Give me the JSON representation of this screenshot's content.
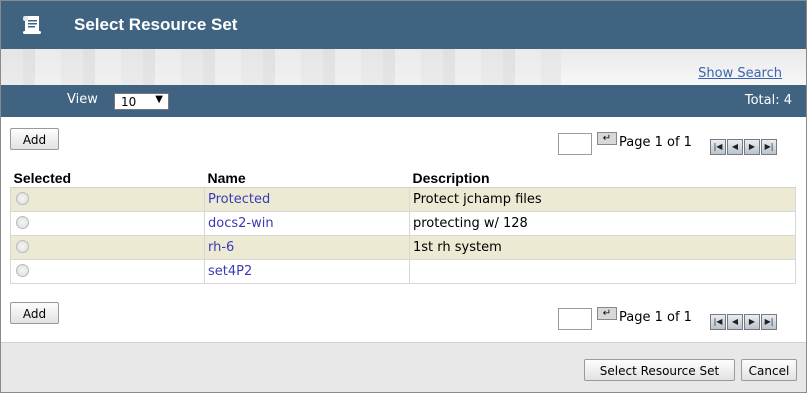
{
  "dialog": {
    "title": "Select Resource Set"
  },
  "search": {
    "show_search_label": "Show Search"
  },
  "viewbar": {
    "view_label": "View",
    "page_size": "10",
    "total_label": "Total: 4"
  },
  "toolbar": {
    "add_label": "Add",
    "page_text": "Page 1 of 1"
  },
  "table": {
    "headers": [
      "Selected",
      "Name",
      "Description"
    ],
    "rows": [
      {
        "name": "Protected",
        "description": "Protect jchamp files"
      },
      {
        "name": "docs2-win",
        "description": "protecting w/ 128"
      },
      {
        "name": "rh-6",
        "description": "1st rh system"
      },
      {
        "name": "set4P2",
        "description": ""
      }
    ]
  },
  "footer": {
    "select_label": "Select Resource Set",
    "cancel_label": "Cancel"
  },
  "icons": {
    "title": "scroll-icon",
    "go": "go-arrow-icon",
    "first": "first-page-icon",
    "prev": "prev-page-icon",
    "next": "next-page-icon",
    "last": "last-page-icon"
  }
}
